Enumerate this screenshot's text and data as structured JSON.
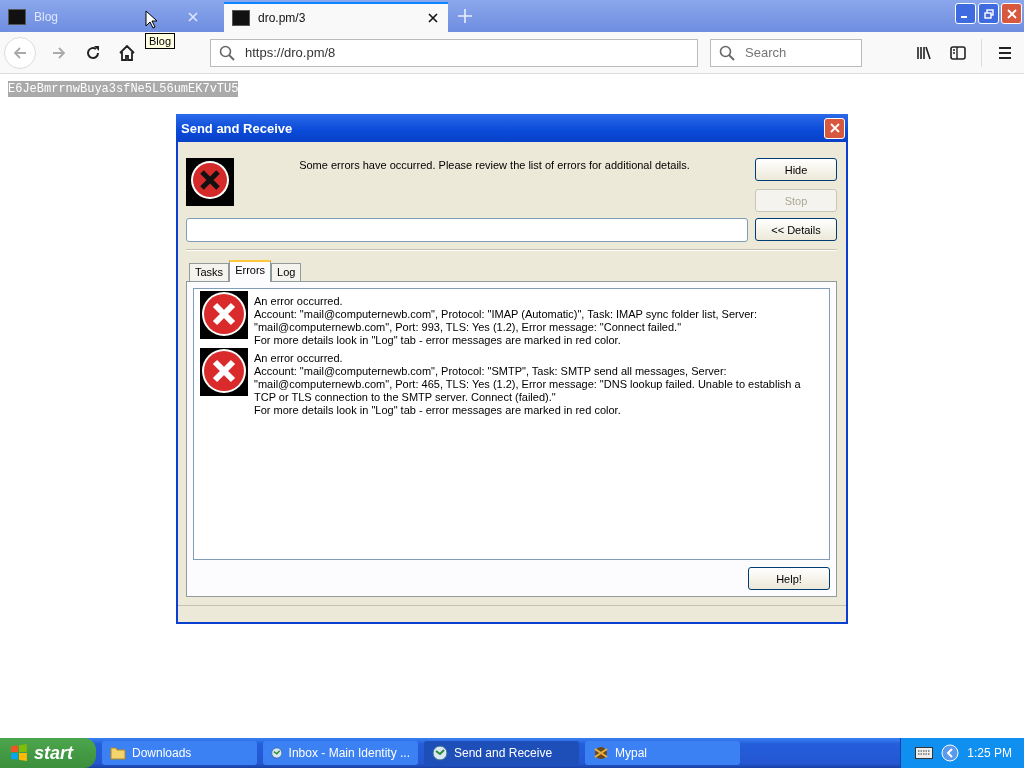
{
  "browser": {
    "tabs": [
      {
        "title": "Blog",
        "selected": false
      },
      {
        "title": "dro.pm/3",
        "selected": true
      }
    ],
    "tooltip": "Blog",
    "url": "https://dro.pm/8",
    "search_placeholder": "Search"
  },
  "page": {
    "selected_text": "E6JeBmrrnwBuya3sfNe5L56umEK7vTU5"
  },
  "dialog": {
    "title": "Send and Receive",
    "message": "Some errors have occurred. Please review the list of errors for additional details.",
    "buttons": [
      {
        "label": "Hide",
        "disabled": false
      },
      {
        "label": "Stop",
        "disabled": true
      },
      {
        "label": "<< Details",
        "disabled": false
      }
    ],
    "tabs": [
      {
        "label": "Tasks",
        "selected": false
      },
      {
        "label": "Errors",
        "selected": true
      },
      {
        "label": "Log",
        "selected": false
      }
    ],
    "errors": [
      {
        "heading": "An error occurred.",
        "lines": [
          "Account: \"mail@computernewb.com\", Protocol: \"IMAP (Automatic)\", Task: IMAP sync folder list, Server:",
          "\"mail@computernewb.com\", Port: 993, TLS: Yes (1.2), Error message: \"Connect failed.\"",
          "For more details look in \"Log\" tab - error messages are marked in red color."
        ]
      },
      {
        "heading": "An error occurred.",
        "lines": [
          "Account: \"mail@computernewb.com\", Protocol: \"SMTP\", Task: SMTP send all messages, Server:",
          "\"mail@computernewb.com\", Port: 465, TLS: Yes (1.2), Error message: \"DNS lookup failed. Unable to establish a",
          "TCP or TLS connection to the SMTP server. Connect (failed).\"",
          "For more details look in \"Log\" tab - error messages are marked in red color."
        ]
      }
    ],
    "help_button": "Help!"
  },
  "taskbar": {
    "start": "start",
    "items": [
      {
        "label": "Downloads",
        "selected": false,
        "kind": "folder"
      },
      {
        "label": "Inbox - Main Identity ...",
        "selected": false,
        "kind": "mail"
      },
      {
        "label": "Send and Receive",
        "selected": true,
        "kind": "mail"
      },
      {
        "label": "Mypal",
        "selected": false,
        "kind": "app"
      }
    ],
    "clock": "1:25 PM"
  }
}
